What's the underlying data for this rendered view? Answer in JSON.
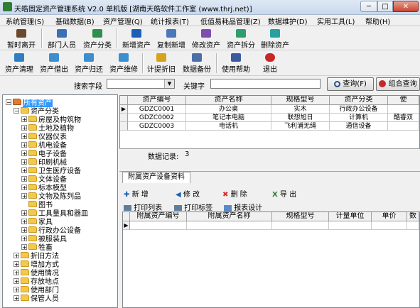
{
  "window": {
    "title": "天皓固定资产管理系统 V2.0 单机版   [湖南天皓软件工作室 (www.thrj.net)]",
    "min": "─",
    "max": "□",
    "close": "✕"
  },
  "menu": [
    "系统管理(S)",
    "基础数据(B)",
    "资产管理(Q)",
    "统计报表(T)",
    "低值易耗品管理(Z)",
    "数据维护(D)",
    "实用工具(L)",
    "帮助(H)"
  ],
  "toolbar1": [
    {
      "label": "暂时离开",
      "icon": "door-exit-icon",
      "color": "#6a4a2a"
    },
    {
      "label": "部门人员",
      "icon": "people-icon",
      "color": "#3b6fb6"
    },
    {
      "label": "资产分类",
      "icon": "category-icon",
      "color": "#2f8f4e"
    },
    {
      "label": "新增资产",
      "icon": "add-plus-icon",
      "color": "#1d5fb8"
    },
    {
      "label": "复制新增",
      "icon": "copy-icon",
      "color": "#4a78b8"
    },
    {
      "label": "修改资产",
      "icon": "edit-icon",
      "color": "#7d4fb0"
    },
    {
      "label": "资产拆分",
      "icon": "split-icon",
      "color": "#2f9e6a"
    },
    {
      "label": "删除资产",
      "icon": "delete-icon",
      "color": "#28a0a0"
    }
  ],
  "toolbar2": [
    {
      "label": "资产清理",
      "icon": "clean-icon",
      "color": "#2f7fc1"
    },
    {
      "label": "资产借出",
      "icon": "lend-icon",
      "color": "#3a8fd0"
    },
    {
      "label": "资产归还",
      "icon": "return-icon",
      "color": "#3a8fd0"
    },
    {
      "label": "资产维修",
      "icon": "repair-icon",
      "color": "#3a8fd0"
    },
    {
      "label": "计提折旧",
      "icon": "depreciation-icon",
      "color": "#d7a21b"
    },
    {
      "label": "数据备份",
      "icon": "backup-icon",
      "color": "#4b6fa8"
    },
    {
      "label": "使用帮助",
      "icon": "help-book-icon",
      "color": "#3b5aa0"
    },
    {
      "label": "退出",
      "icon": "exit-icon",
      "color": "#c62828"
    }
  ],
  "search": {
    "field_label": "搜索字段",
    "keyword_label": "关键字",
    "field_value": "",
    "keyword_value": "",
    "query_button": "查询(F)",
    "combo_button": "组合查询"
  },
  "tree": [
    {
      "label": "所有资产",
      "level": 0,
      "exp": "⊟",
      "selected": true
    },
    {
      "label": "资产分类",
      "level": 1,
      "exp": "⊟"
    },
    {
      "label": "房屋及构筑物",
      "level": 2,
      "exp": "⊞"
    },
    {
      "label": "土地及植物",
      "level": 2,
      "exp": "⊞"
    },
    {
      "label": "仪器仪表",
      "level": 2,
      "exp": "⊞"
    },
    {
      "label": "机电设备",
      "level": 2,
      "exp": "⊞"
    },
    {
      "label": "电子设备",
      "level": 2,
      "exp": "⊞"
    },
    {
      "label": "印刷机械",
      "level": 2,
      "exp": "⊞"
    },
    {
      "label": "卫生医疗设备",
      "level": 2,
      "exp": "⊞"
    },
    {
      "label": "文体设备",
      "level": 2,
      "exp": "⊞"
    },
    {
      "label": "标本模型",
      "level": 2,
      "exp": "⊞"
    },
    {
      "label": "文物及陈列品",
      "level": 2,
      "exp": "⊞"
    },
    {
      "label": "图书",
      "level": 2,
      "exp": ""
    },
    {
      "label": "工具量具和器皿",
      "level": 2,
      "exp": "⊞"
    },
    {
      "label": "家具",
      "level": 2,
      "exp": "⊞"
    },
    {
      "label": "行政办公设备",
      "level": 2,
      "exp": "⊞"
    },
    {
      "label": "被服装具",
      "level": 2,
      "exp": "⊞"
    },
    {
      "label": "牲畜",
      "level": 2,
      "exp": "⊞"
    },
    {
      "label": "折旧方法",
      "level": 1,
      "exp": "⊞"
    },
    {
      "label": "增加方式",
      "level": 1,
      "exp": "⊞"
    },
    {
      "label": "使用情况",
      "level": 1,
      "exp": "⊞"
    },
    {
      "label": "存放地点",
      "level": 1,
      "exp": "⊞"
    },
    {
      "label": "使用部门",
      "level": 1,
      "exp": "⊞"
    },
    {
      "label": "保管人员",
      "level": 1,
      "exp": "⊞"
    }
  ],
  "main_grid": {
    "columns": [
      "资产编号",
      "资产名称",
      "规格型号",
      "资产分类",
      "使"
    ],
    "rows": [
      [
        "GDZC0001",
        "办公桌",
        "实木",
        "行政办公设备",
        ""
      ],
      [
        "GDZC0002",
        "笔记本电脑",
        "联想旭日",
        "计算机",
        "酷睿双"
      ],
      [
        "GDZC0003",
        "电话机",
        "飞利浦无绳",
        "通信设备",
        ""
      ]
    ],
    "record_label": "数据记录:",
    "record_count": "3"
  },
  "sub_tab": "附属资产设备资料",
  "sub_toolbar": {
    "add": "新 增",
    "edit": "修 改",
    "delete": "删 除",
    "export": "导 出",
    "print_list": "打印列表",
    "print_label": "打印标签",
    "report_design": "报表设计"
  },
  "sub_grid": {
    "columns": [
      "附属资产编号",
      "附属资产名称",
      "规格型号",
      "计量单位",
      "单价",
      "数"
    ]
  }
}
